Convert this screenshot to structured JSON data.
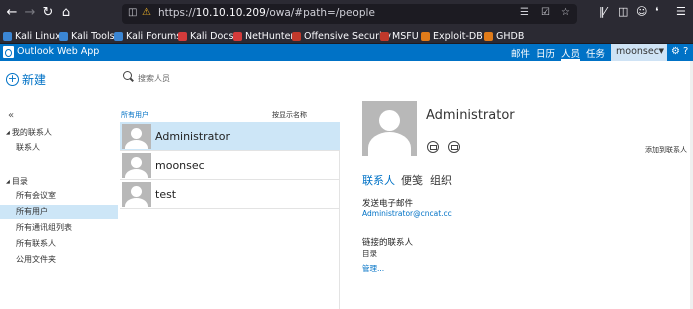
{
  "browser": {
    "url_host": "10.10.10.209",
    "url_scheme": "https://",
    "url_path": "/owa/#path=/people",
    "bookmarks": [
      "Kali Linux",
      "Kali Tools",
      "Kali Forums",
      "Kali Docs",
      "NetHunter",
      "Offensive Security",
      "MSFU",
      "Exploit-DB",
      "GHDB"
    ],
    "bookmark_colors": [
      "#3b86d4",
      "#3b86d4",
      "#3b86d4",
      "#d43b3b",
      "#d43b3b",
      "#c0392b",
      "#c0392b",
      "#e07b1a",
      "#e07b1a"
    ]
  },
  "owa": {
    "app_title": "Outlook Web App",
    "nav": [
      "邮件",
      "日历",
      "人员",
      "任务"
    ],
    "active_nav": "人员",
    "user": "moonsec",
    "accent": "#0072c6"
  },
  "sidebar": {
    "new_label": "新建",
    "my_contacts_heading": "我的联系人",
    "my_contacts_items": [
      "联系人"
    ],
    "directory_heading": "目录",
    "directory_items": [
      "所有会议室",
      "所有用户",
      "所有通讯组列表",
      "所有联系人",
      "公用文件夹"
    ],
    "selected": "所有用户"
  },
  "list": {
    "search_placeholder": "搜索人员",
    "header_left": "所有用户",
    "header_right": "按显示名称",
    "people": [
      {
        "name": "Administrator",
        "selected": true
      },
      {
        "name": "moonsec",
        "selected": false
      },
      {
        "name": "test",
        "selected": false
      }
    ]
  },
  "detail": {
    "name": "Administrator",
    "add_contact": "添加到联系人",
    "tabs": [
      "联系人",
      "便笺",
      "组织"
    ],
    "active_tab": "联系人",
    "email_label": "发送电子邮件",
    "email_value": "Administrator@cncat.cc",
    "linked_label": "链接的联系人",
    "linked_source": "目录",
    "manage_link": "管理..."
  }
}
